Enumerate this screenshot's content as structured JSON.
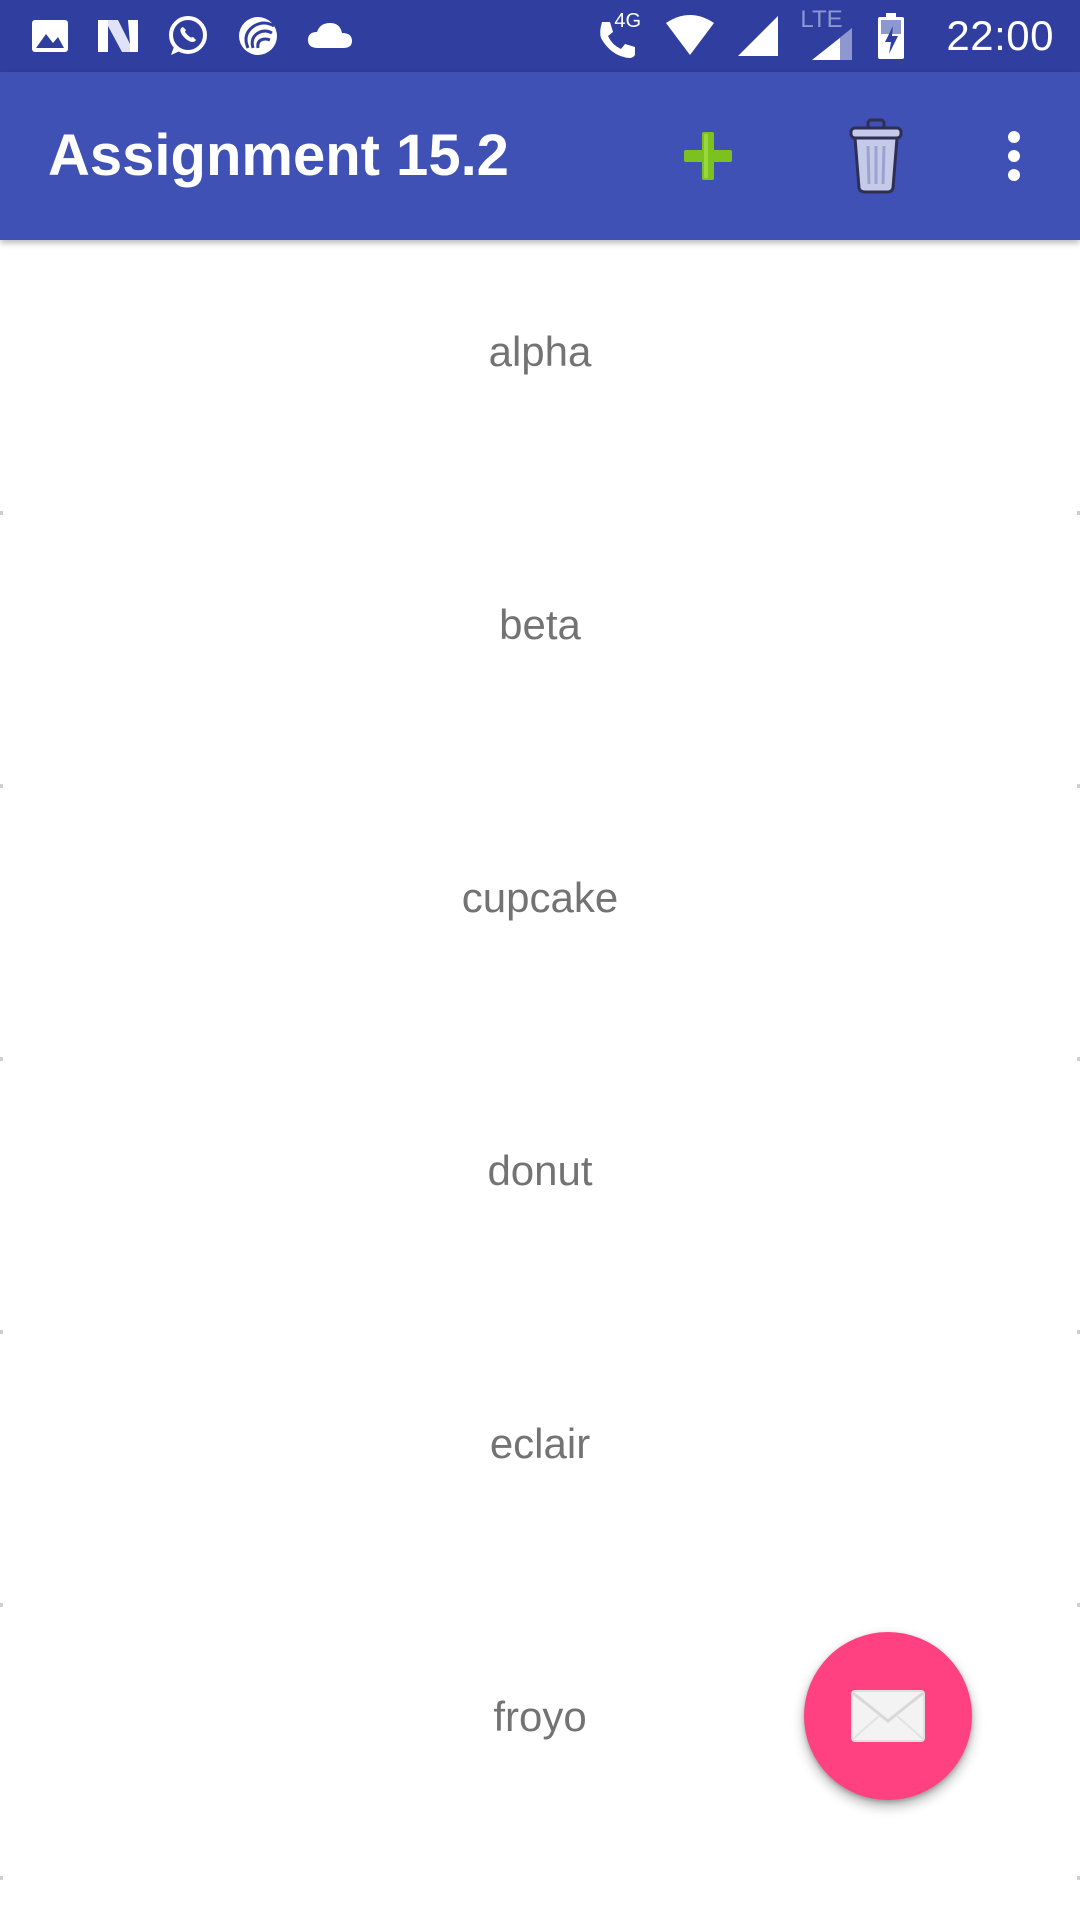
{
  "status_bar": {
    "left_icons": [
      "gallery-icon",
      "n-app-icon",
      "whatsapp-icon",
      "torrent-icon",
      "cloud-icon"
    ],
    "right_icons": [
      "volte-call-icon",
      "wifi-icon",
      "signal-icon",
      "lte-signal-icon",
      "battery-charging-icon"
    ],
    "network_4g": "4G",
    "network_lte": "LTE",
    "time": "22:00"
  },
  "app_bar": {
    "title": "Assignment 15.2",
    "actions": [
      "add-icon",
      "delete-icon",
      "more-options-icon"
    ]
  },
  "list": {
    "items": [
      {
        "label": "alpha"
      },
      {
        "label": "beta"
      },
      {
        "label": "cupcake"
      },
      {
        "label": "donut"
      },
      {
        "label": "eclair"
      },
      {
        "label": "froyo"
      }
    ]
  },
  "fab": {
    "icon": "mail-icon"
  },
  "colors": {
    "status_bar": "#303F9F",
    "app_bar": "#3F51B5",
    "fab": "#FF4081",
    "add_icon": "#7CC11F",
    "list_text": "#737373"
  }
}
